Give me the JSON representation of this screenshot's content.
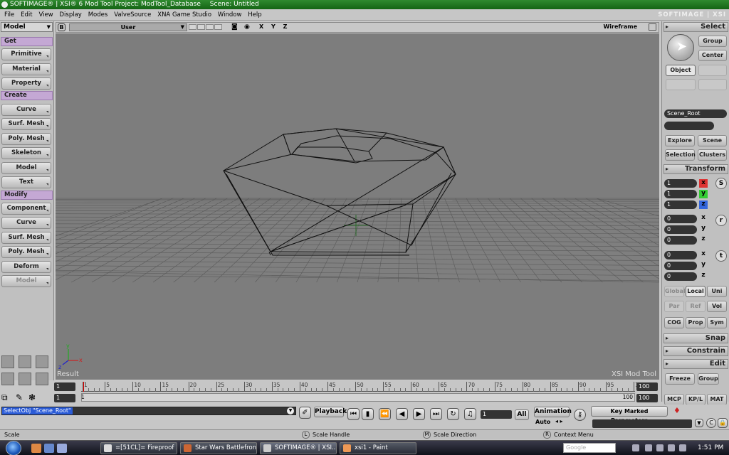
{
  "titlebar": {
    "app": "SOFTIMAGE® | XSI® 6 Mod Tool Project: ModTool_Database",
    "scene": "Scene: Untitled"
  },
  "menubar": {
    "items": [
      "File",
      "Edit",
      "View",
      "Display",
      "Modes",
      "ValveSource",
      "XNA Game Studio",
      "Window",
      "Help"
    ],
    "brand": "SOFTIMAGE | XSI"
  },
  "left": {
    "mode": "Model",
    "get_label": "Get",
    "get_buttons": [
      "Primitive",
      "Material",
      "Property"
    ],
    "create_label": "Create",
    "create_buttons": [
      "Curve",
      "Surf. Mesh",
      "Poly. Mesh",
      "Skeleton",
      "Model",
      "Text"
    ],
    "modify_label": "Modify",
    "modify_buttons": [
      "Component",
      "Curve",
      "Surf. Mesh",
      "Poly. Mesh",
      "Deform",
      "Model"
    ]
  },
  "viewport": {
    "camera": "User",
    "axes": [
      "X",
      "Y",
      "Z"
    ],
    "display_mode": "Wireframe",
    "result_label": "Result",
    "watermark": "XSI Mod Tool",
    "gizmo_x": "x",
    "gizmo_y": "y",
    "gizmo_z": "z"
  },
  "right": {
    "select_title": "Select",
    "group_btn": "Group",
    "center_btn": "Center",
    "object_btn": "Object",
    "scene_root": "Scene_Root",
    "explore_btn": "Explore",
    "scene_btn": "Scene",
    "selection_btn": "Selection",
    "clusters_btn": "Clusters",
    "transform_title": "Transform",
    "scale_values": [
      "1",
      "1",
      "1"
    ],
    "rotate_values": [
      "0",
      "0",
      "0"
    ],
    "translate_values": [
      "0",
      "0",
      "0"
    ],
    "axis_x": "x",
    "axis_y": "y",
    "axis_z": "z",
    "s_label": "S",
    "r_label": "r",
    "t_label": "t",
    "global_btn": "Global",
    "local_btn": "Local",
    "uni_btn": "Uni",
    "par_btn": "Par",
    "ref_btn": "Ref",
    "vol_btn": "Vol",
    "cog_btn": "COG",
    "prop_btn": "Prop",
    "sym_btn": "Sym",
    "snap_title": "Snap",
    "constrain_title": "Constrain",
    "edit_title": "Edit",
    "freeze_btn": "Freeze",
    "group_btn2": "Group",
    "tab_mcp": "MCP",
    "tab_kpl": "KP/L",
    "tab_mat": "MAT"
  },
  "timeline": {
    "start": "1",
    "start2": "1",
    "end": "100",
    "end2": "100",
    "small_end": "100",
    "small_start": "1",
    "ticks": [
      "1",
      "5",
      "10",
      "15",
      "20",
      "25",
      "30",
      "35",
      "40",
      "45",
      "50",
      "55",
      "60",
      "65",
      "70",
      "75",
      "80",
      "85",
      "90",
      "95",
      "100"
    ]
  },
  "cmdbar": {
    "command": "SelectObj \"Scene_Root\"",
    "playback_label": "Playback",
    "frame_value": "1",
    "all_label": "All",
    "animation_label": "Animation",
    "auto_label": "Auto",
    "key_marked": "Key Marked Parameters"
  },
  "statusbar": {
    "mode": "Scale",
    "left_mouse": "L",
    "left_text": "Scale Handle",
    "mid_mouse": "M",
    "mid_text": "Scale Direction",
    "right_mouse": "R",
    "right_text": "Context Menu"
  },
  "taskbar": {
    "tasks": [
      "=[51CL]= Fireproof ...",
      "Star Wars Battlefron...",
      "SOFTIMAGE® | XSI...",
      "xsi1 - Paint"
    ],
    "search_placeholder": "Google",
    "clock": "1:51 PM"
  }
}
